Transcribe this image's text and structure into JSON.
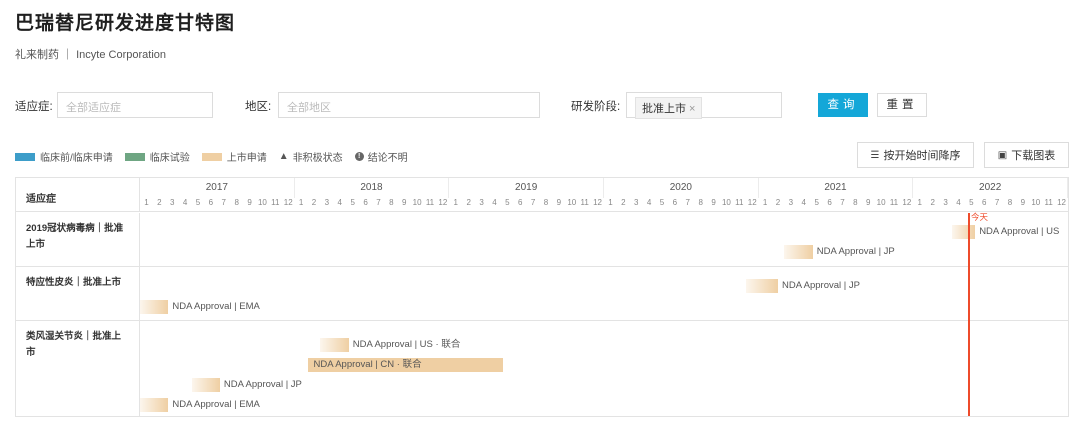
{
  "page": {
    "title": "巴瑞替尼研发进度甘特图",
    "subtitle": "礼来制药 ｜ Incyte Corporation"
  },
  "filters": {
    "indication_label": "适应症:",
    "indication_placeholder": "全部适应症",
    "region_label": "地区:",
    "region_placeholder": "全部地区",
    "stage_label": "研发阶段:",
    "stage_tag": "批准上市",
    "stage_tag_close": "×",
    "query_label": "查询",
    "reset_label": "重置"
  },
  "legend": {
    "items": [
      {
        "label": "临床前/临床申请",
        "color": "#3d9dc9"
      },
      {
        "label": "临床试验",
        "color": "#6fa683"
      },
      {
        "label": "上市申请",
        "color": "#efcfa3"
      }
    ],
    "inactive_label": "非积极状态",
    "unclear_label": "结论不明"
  },
  "toolbar": {
    "sort_label": "按开始时间降序",
    "download_label": "下载图表"
  },
  "gantt": {
    "header_label": "适应症",
    "years": [
      "2017",
      "2018",
      "2019",
      "2020",
      "2021",
      "2022"
    ],
    "months": [
      "1",
      "2",
      "3",
      "4",
      "5",
      "6",
      "7",
      "8",
      "9",
      "10",
      "11",
      "12"
    ],
    "today_label": "今天",
    "rows": [
      {
        "indication": "2019冠状病毒病｜批准上市",
        "bars": [
          {
            "label": "NDA Approval | US",
            "start": "2022-04",
            "months": 1.8,
            "style": "fade"
          },
          {
            "label": "NDA Approval | JP",
            "start": "2021-03",
            "months": 2.2,
            "style": "fade"
          }
        ]
      },
      {
        "indication": "特应性皮炎｜批准上市",
        "bars": [
          {
            "label": "NDA Approval | JP",
            "start": "2020-12",
            "months": 2.5,
            "style": "fade"
          },
          {
            "label": "NDA Approval | EMA",
            "start": "2017-01",
            "months": 2.2,
            "style": "fade"
          }
        ]
      },
      {
        "indication": "类风湿关节炎｜批准上市",
        "bars": [
          {
            "label": "NDA Approval | US · 联合",
            "start": "2018-03",
            "months": 2.2,
            "style": "fade"
          },
          {
            "label": "NDA Approval | CN · 联合",
            "start": "2018-02",
            "months": 15.2,
            "style": "solid"
          },
          {
            "label": "NDA Approval | JP",
            "start": "2017-05",
            "months": 2.2,
            "style": "fade"
          },
          {
            "label": "NDA Approval | EMA",
            "start": "2017-01",
            "months": 2.2,
            "style": "fade"
          }
        ]
      }
    ]
  }
}
